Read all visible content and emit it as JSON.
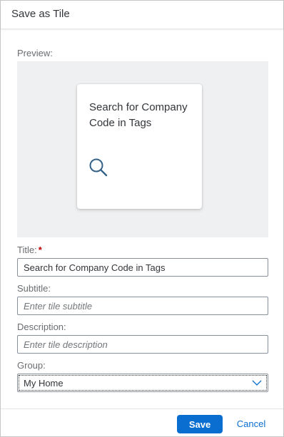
{
  "dialog": {
    "title": "Save as Tile"
  },
  "preview": {
    "label": "Preview:",
    "tile_title": "Search for Company Code in Tags",
    "tile_icon": "search-icon"
  },
  "fields": {
    "title": {
      "label": "Title:",
      "required_marker": "*",
      "value": "Search for Company Code in Tags"
    },
    "subtitle": {
      "label": "Subtitle:",
      "placeholder": "Enter tile subtitle"
    },
    "description": {
      "label": "Description:",
      "placeholder": "Enter tile description"
    },
    "group": {
      "label": "Group:",
      "value": "My Home"
    }
  },
  "footer": {
    "save_label": "Save",
    "cancel_label": "Cancel"
  },
  "colors": {
    "accent": "#0a6ed1",
    "required": "#bb0000",
    "preview_background": "#eff0f1"
  }
}
